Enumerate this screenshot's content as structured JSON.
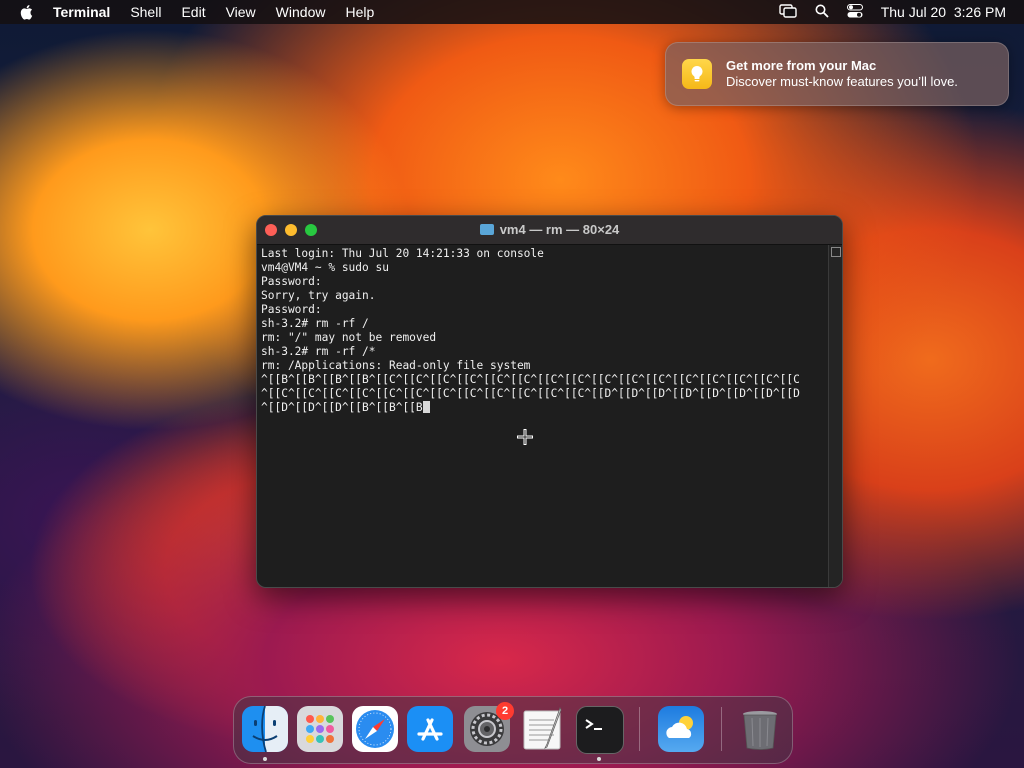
{
  "menubar": {
    "app_name": "Terminal",
    "menus": [
      "Shell",
      "Edit",
      "View",
      "Window",
      "Help"
    ],
    "clock_date": "Thu Jul 20",
    "clock_time": "3:26 PM"
  },
  "notification": {
    "title": "Get more from your Mac",
    "body": "Discover must-know features you’ll love."
  },
  "terminal": {
    "window_title": "vm4 — rm — 80×24",
    "lines": [
      "Last login: Thu Jul 20 14:21:33 on console",
      "vm4@VM4 ~ % sudo su",
      "Password:",
      "Sorry, try again.",
      "Password:",
      "sh-3.2# rm -rf /",
      "rm: \"/\" may not be removed",
      "sh-3.2# rm -rf /*",
      "rm: /Applications: Read-only file system",
      "^[[B^[[B^[[B^[[B^[[C^[[C^[[C^[[C^[[C^[[C^[[C^[[C^[[C^[[C^[[C^[[C^[[C^[[C^[[C^[[C",
      "^[[C^[[C^[[C^[[C^[[C^[[C^[[C^[[C^[[C^[[C^[[C^[[C^[[D^[[D^[[D^[[D^[[D^[[D^[[D^[[D",
      "^[[D^[[D^[[D^[[B^[[B^[[B"
    ]
  },
  "dock": {
    "items": [
      "Finder",
      "Launchpad",
      "Safari",
      "App Store",
      "System Settings",
      "TextEdit",
      "Terminal",
      "Weather",
      "Trash"
    ],
    "settings_badge": "2"
  },
  "colors": {
    "terminal_bg": "#1e1e1e",
    "close": "#fe5f57",
    "minimize": "#febc2e",
    "zoom": "#28c840",
    "badge": "#ff3b30"
  }
}
